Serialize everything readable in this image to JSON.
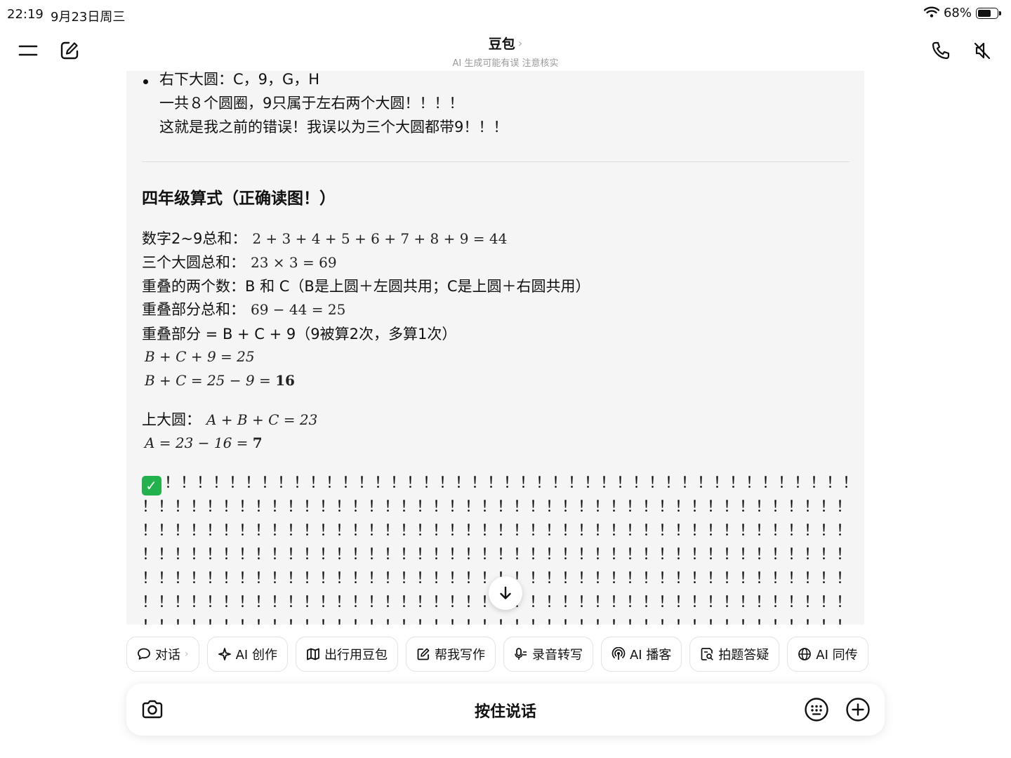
{
  "status_bar": {
    "time": "22:19",
    "date": "9月23日周三",
    "battery": "68%",
    "battery_level": 0.68
  },
  "header": {
    "title": "豆包",
    "subtitle": "AI 生成可能有误 注意核实"
  },
  "content": {
    "bullet": {
      "line1": "右下大圆：C，9，G，H",
      "line2": "一共８个圆圈，9只属于左右两个大圆！！！！",
      "line3": "这就是我之前的错误！我误以为三个大圆都带9！！！"
    },
    "heading": "四年级算式（正确读图！）",
    "rows": [
      {
        "label": "数字2~9总和：",
        "math": "2 + 3 + 4 + 5 + 6 + 7 + 8 + 9 = 44"
      },
      {
        "label": "三个大圆总和：",
        "math": "23 × 3 = 69"
      },
      {
        "label": "重叠的两个数：B 和 C（B是上圆＋左圆共用；C是上圆＋右圆共用）",
        "math": ""
      },
      {
        "label": "重叠部分总和：",
        "math": "69 − 44 = 25"
      },
      {
        "label": "重叠部分 = B + C + 9（9被算2次，多算1次）",
        "math": ""
      }
    ],
    "eq1": "B + C + 9 = 25",
    "eq2_prefix": "B + C = 25 − 9 = ",
    "eq2_result": "16",
    "top_circle_label": "上大圆：",
    "top_circle_math": "A + B + C = 23",
    "eq3_prefix": "A = 23 − 16 = ",
    "eq3_result": "7",
    "check_line": "！！！！！！！！！！！！！！！！！！！！！！！！！！！！！！！！！！！！！！！！！！！！！！！！！！！！！！！！！！！！！！！！！！！！！！！！！！！！！！！！！！！！",
    "bang_line": "！！！！！！！！！！！！！！！！！！！！！！！！！！！！！！！！！！！！！！！！！！！！！！！！！！！！！！！！！！！！！！！！！！！！！！！！！！！！！！！！！！！！！！"
  },
  "chips": [
    {
      "label": "对话",
      "icon": "chat-bubble-icon"
    },
    {
      "label": "AI 创作",
      "icon": "sparkle-icon"
    },
    {
      "label": "出行用豆包",
      "icon": "map-icon"
    },
    {
      "label": "帮我写作",
      "icon": "edit-icon"
    },
    {
      "label": "录音转写",
      "icon": "mic-text-icon"
    },
    {
      "label": "AI 播客",
      "icon": "podcast-icon"
    },
    {
      "label": "拍题答疑",
      "icon": "photo-question-icon"
    },
    {
      "label": "AI 同传",
      "icon": "globe-icon"
    }
  ],
  "input": {
    "push_to_talk": "按住说话"
  }
}
